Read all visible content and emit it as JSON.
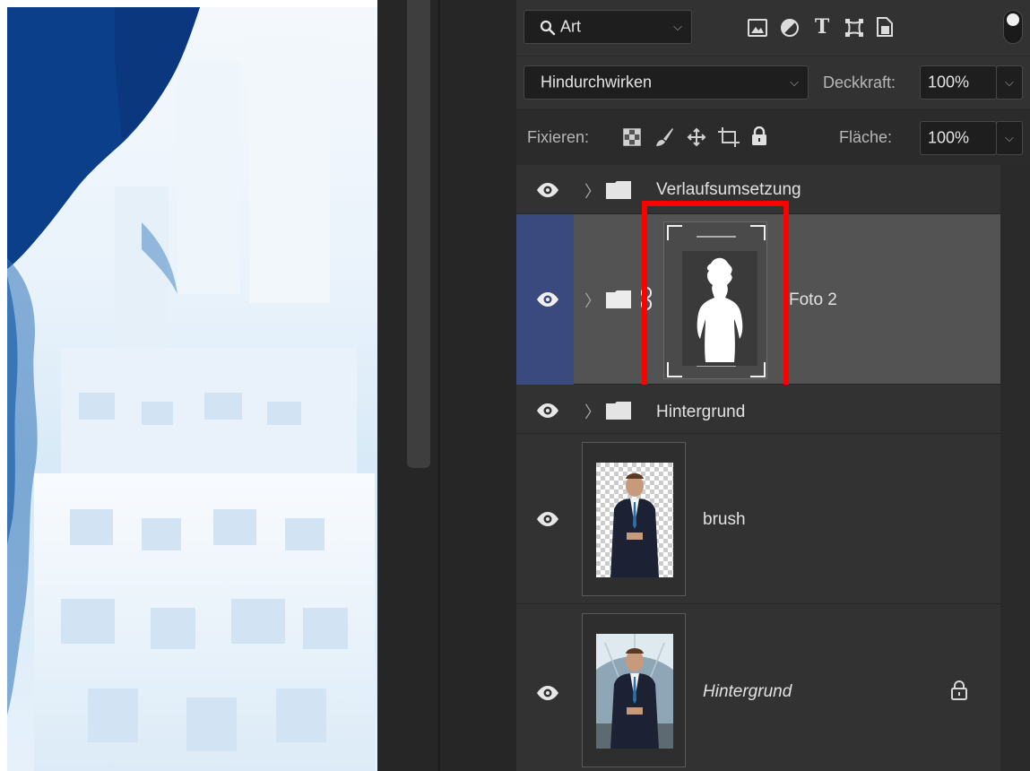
{
  "filter": {
    "kind_value": "Art",
    "icons": [
      "image-filter-icon",
      "adjustment-filter-icon",
      "text-filter-icon",
      "shape-filter-icon",
      "smart-object-filter-icon"
    ]
  },
  "blend": {
    "mode": "Hindurchwirken",
    "opacity_label": "Deckkraft:",
    "opacity_value": "100%"
  },
  "lock": {
    "label": "Fixieren:",
    "fill_label": "Fläche:",
    "fill_value": "100%",
    "icons": [
      "lock-transparent-icon",
      "lock-paint-icon",
      "lock-position-icon",
      "lock-artboard-icon",
      "lock-all-icon"
    ]
  },
  "layers": [
    {
      "name": "Verlaufsumsetzung",
      "type": "group",
      "visible": true,
      "selected": false
    },
    {
      "name": "Foto 2",
      "type": "group",
      "visible": true,
      "selected": true,
      "has_mask": true,
      "highlighted": true
    },
    {
      "name": "Hintergrund",
      "type": "group",
      "visible": true,
      "selected": false
    },
    {
      "name": "brush",
      "type": "pixel",
      "visible": true,
      "selected": false
    },
    {
      "name": "Hintergrund",
      "type": "background",
      "visible": true,
      "selected": false,
      "locked": true
    }
  ],
  "colors": {
    "panel": "#323232",
    "selected_row": "#535353",
    "selected_eye_cell": "#3a4a7e",
    "highlight": "#ff0000",
    "canvas_blue": "#0b3f8a"
  }
}
